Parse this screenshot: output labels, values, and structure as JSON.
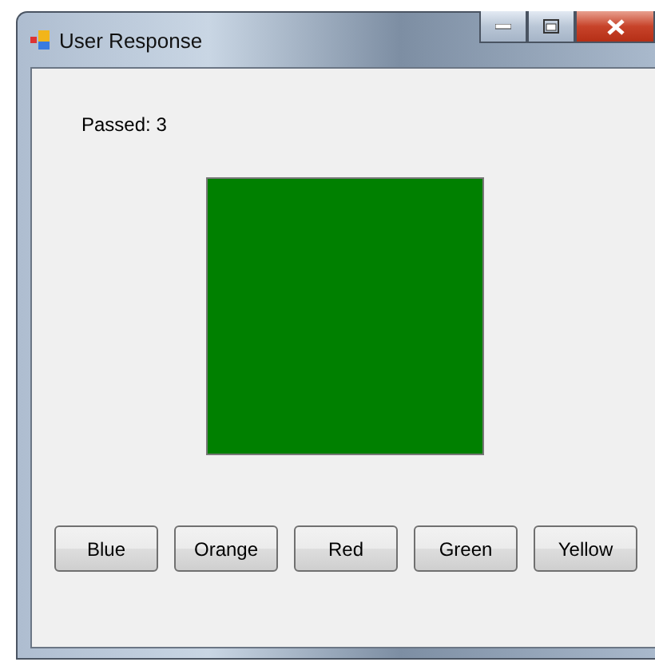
{
  "window": {
    "title": "User Response"
  },
  "passed_label": "Passed: 3",
  "swatch": {
    "color": "#008000"
  },
  "buttons": [
    "Blue",
    "Orange",
    "Red",
    "Green",
    "Yellow"
  ]
}
